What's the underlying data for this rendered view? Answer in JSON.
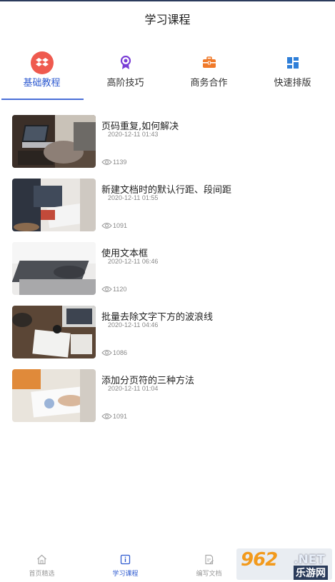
{
  "header": {
    "title": "学习课程"
  },
  "tabs": [
    {
      "label": "基础教程",
      "icon": "dropbox-icon",
      "active": true
    },
    {
      "label": "高阶技巧",
      "icon": "award-icon",
      "active": false
    },
    {
      "label": "商务合作",
      "icon": "briefcase-icon",
      "active": false
    },
    {
      "label": "快速排版",
      "icon": "layout-grid-icon",
      "active": false
    }
  ],
  "articles": [
    {
      "title": "页码重复,如何解决",
      "date": "2020-12-11  01:43",
      "views": "1139"
    },
    {
      "title": "新建文档时的默认行距、段间距",
      "date": "2020-12-11  01:55",
      "views": "1091"
    },
    {
      "title": "使用文本框",
      "date": "2020-12-11  06:46",
      "views": "1120"
    },
    {
      "title": "批量去除文字下方的波浪线",
      "date": "2020-12-11  04:46",
      "views": "1086"
    },
    {
      "title": "添加分页符的三种方法",
      "date": "2020-12-11  01:04",
      "views": "1091"
    }
  ],
  "bottom_nav": [
    {
      "label": "首页精选",
      "icon": "home-icon",
      "active": false
    },
    {
      "label": "学习课程",
      "icon": "info-book-icon",
      "active": true
    },
    {
      "label": "编写文档",
      "icon": "edit-document-icon",
      "active": false
    }
  ],
  "watermark": {
    "number": "962",
    "dot_net": ".NET",
    "name": "乐游网"
  },
  "colors": {
    "accent": "#2f5bd0",
    "tab_icon_bg": "#ef5a4f",
    "award": "#7a3ed6",
    "briefcase": "#f07a2a",
    "grid": "#2f7fd8"
  }
}
